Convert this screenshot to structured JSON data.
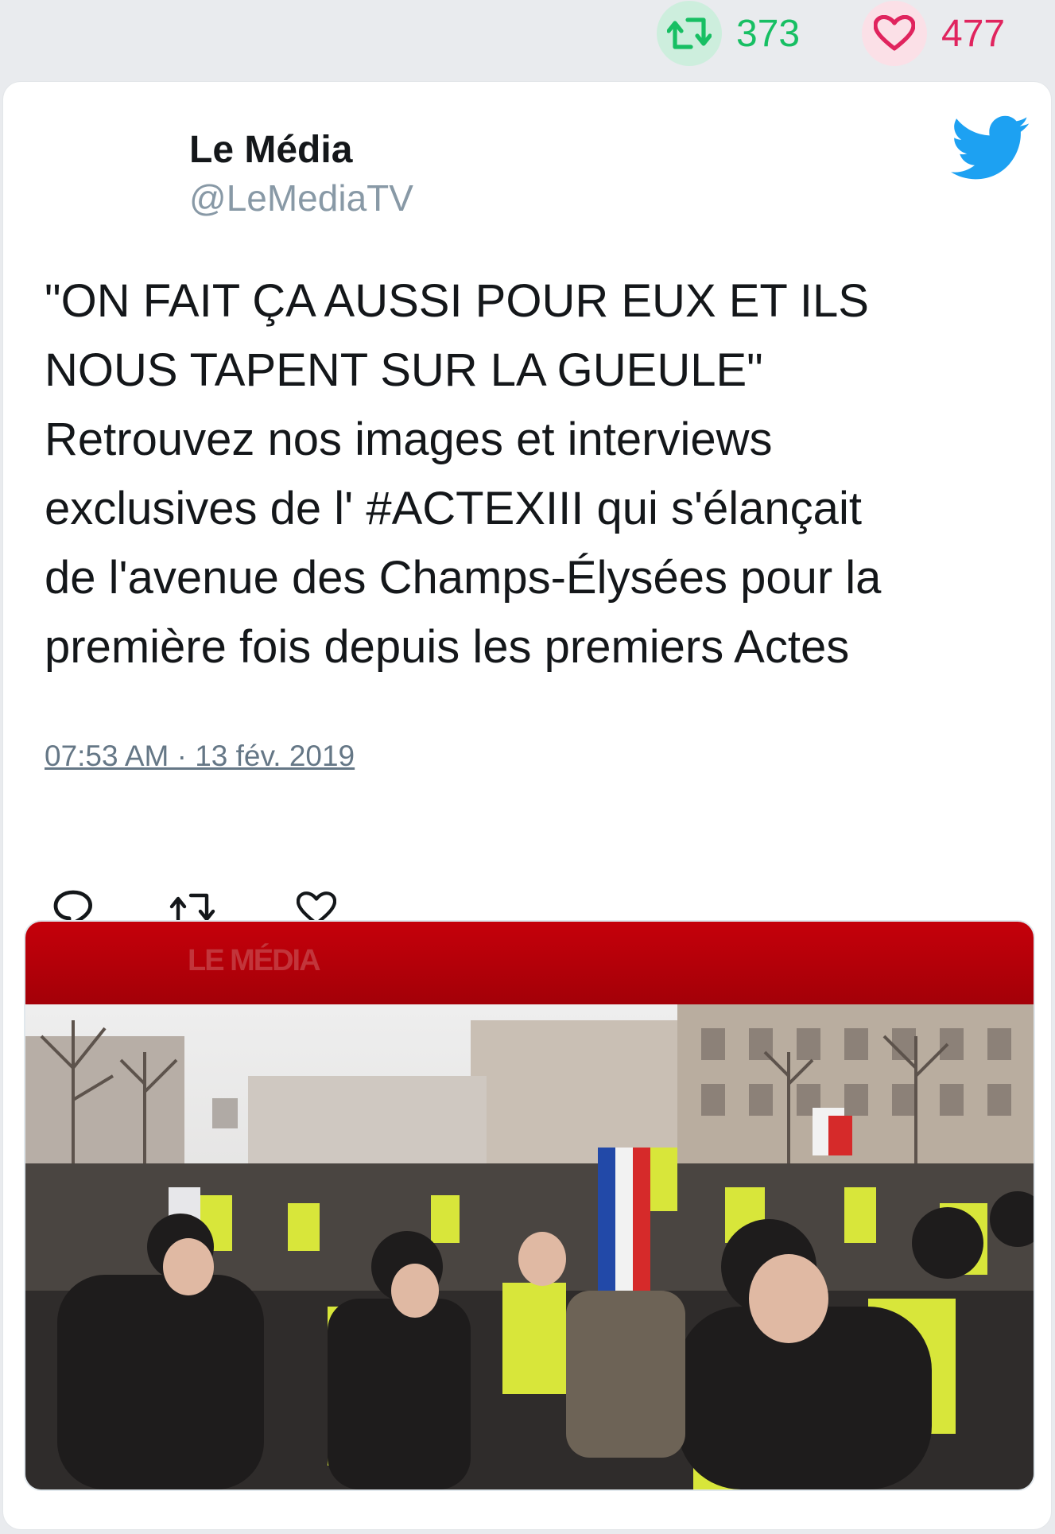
{
  "stats": {
    "retweets": "373",
    "likes": "477",
    "retweet_icon": "retweet-icon",
    "like_icon": "heart-icon"
  },
  "tweet": {
    "author_name": "Le Média",
    "author_handle": "@LeMediaTV",
    "text": "\"ON FAIT ÇA AUSSI POUR EUX ET ILS\nNOUS TAPENT SUR LA GUEULE\"\nRetrouvez nos images et interviews\nexclusives de l' #ACTEXIII qui s'élançait\nde l'avenue des Champs-Élysées pour la\npremière fois depuis les premiers Actes",
    "timestamp": "07:53 AM · 13 fév. 2019",
    "platform_icon": "twitter-bird-icon"
  },
  "actions": {
    "reply_icon": "reply-icon",
    "retweet_icon": "retweet-icon",
    "like_icon": "heart-icon"
  },
  "media": {
    "banner_logo": "LE MÉDIA",
    "description_icon": "video-still-photo"
  },
  "colors": {
    "retweet_green": "#17bf63",
    "like_red": "#e0245e",
    "twitter_blue": "#1da1f2",
    "banner_red": "#c5000a"
  }
}
